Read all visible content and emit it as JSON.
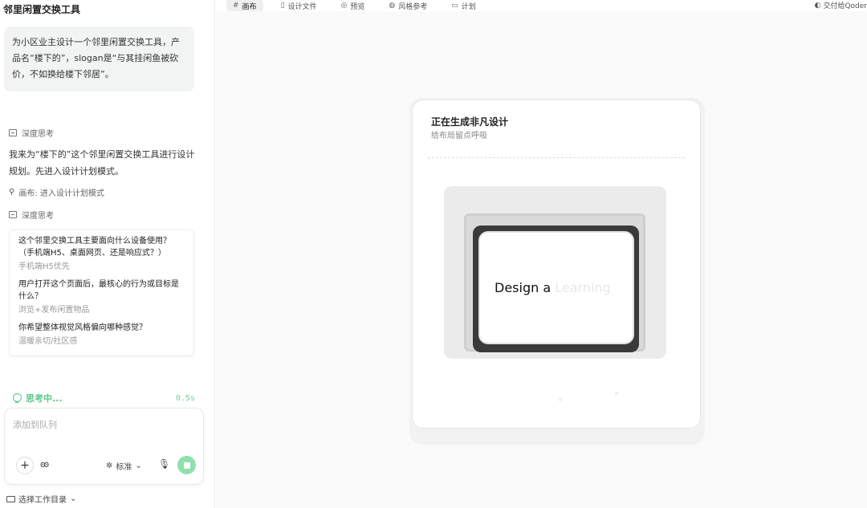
{
  "sidebar": {
    "app_title": "邻里闲置交换工具",
    "prompt": "为小区业主设计一个邻里闲置交换工具，产品名“楼下的”，slogan是“与其挂闲鱼被砍价，不如换给楼下邻居”。",
    "think_label_1": "深度思考",
    "reply": "我来为“楼下的”这个邻里闲置交换工具进行设计规划。先进入设计计划模式。",
    "tool_call": "画布: 进入设计计划模式",
    "think_label_2": "深度思考",
    "qa": [
      {
        "q": "这个邻里交换工具主要面向什么设备使用？（手机端H5、桌面网页、还是响应式？）",
        "a": "手机端H5优先"
      },
      {
        "q": "用户打开这个页面后，最核心的行为或目标是什么？",
        "a": "浏览+发布闲置物品"
      },
      {
        "q": "你希望整体视觉风格偏向哪种感觉？",
        "a": "温暖亲切/社区感"
      }
    ],
    "status_label": "思考中...",
    "status_time": "0.5s",
    "input_placeholder": "添加到队列",
    "add_label": "+",
    "glasses_label": "ꙭ",
    "mode_label": "标准",
    "workdir_label": "选择工作目录"
  },
  "tabs": [
    {
      "icon": "#",
      "label": "画布"
    },
    {
      "icon": "▯",
      "label": "设计文件"
    },
    {
      "icon": "◎",
      "label": "预览"
    },
    {
      "icon": "◍",
      "label": "风格参考"
    },
    {
      "icon": "▭",
      "label": "计划"
    }
  ],
  "deliver_label": "交付给Qoder",
  "generating": {
    "title": "正在生成非凡设计",
    "subtitle": "给布局留点呼吸",
    "art_text_main": "Design a",
    "art_text_fade": "Learning"
  },
  "colors": {
    "accent_green": "#5cc78a",
    "send_button": "#8fe0ae"
  }
}
